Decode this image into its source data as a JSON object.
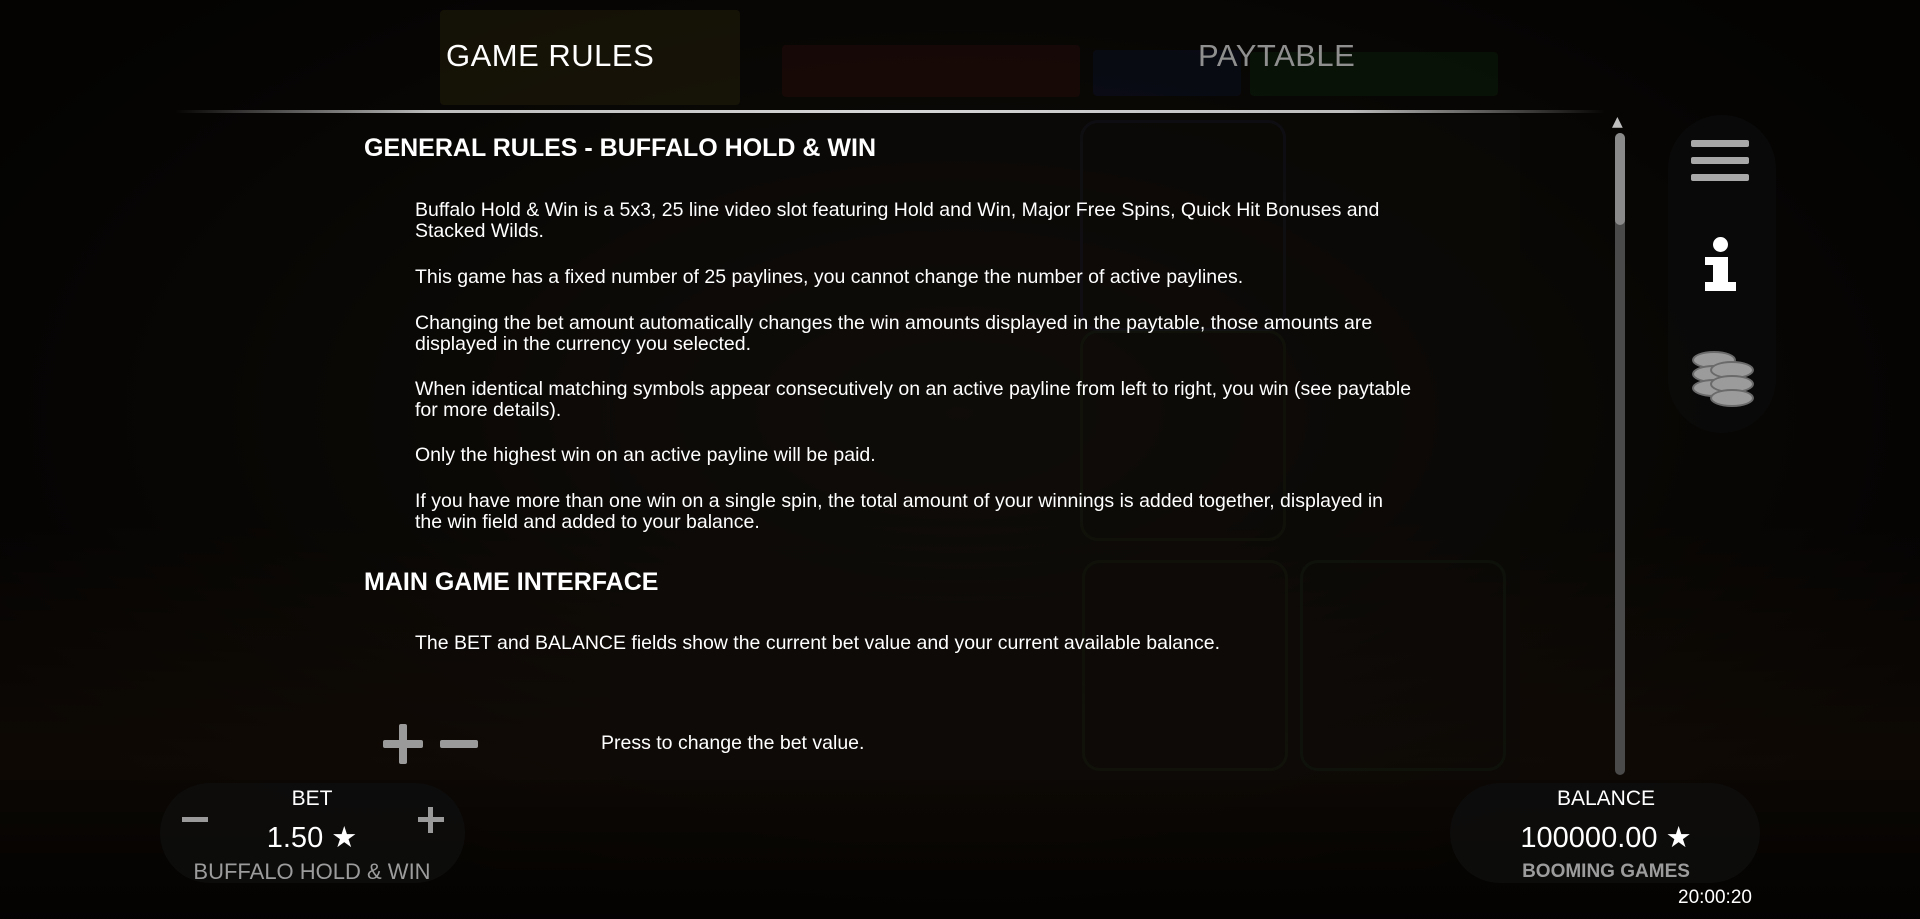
{
  "tabs": {
    "game_rules": "GAME RULES",
    "paytable": "PAYTABLE"
  },
  "sections": [
    {
      "title": "GENERAL RULES - BUFFALO HOLD & WIN",
      "paragraphs": [
        "Buffalo Hold & Win is a 5x3, 25 line video slot featuring Hold and Win, Major Free Spins, Quick Hit Bonuses and Stacked Wilds.",
        "This game has a fixed number of 25 paylines, you cannot change the number of active paylines.",
        "Changing the bet amount automatically changes the win amounts displayed in the paytable, those amounts are displayed in the currency you selected.",
        "When identical matching symbols appear consecutively on an active payline from left to right, you win (see paytable for more details).",
        "Only the highest win on an active payline will be paid.",
        "If you have more than one win on a single spin, the total amount of your winnings is added together, displayed in the win field and added to your balance."
      ]
    },
    {
      "title": "MAIN GAME INTERFACE",
      "paragraphs": [
        "The BET and BALANCE fields show the current bet value and your current available balance."
      ]
    }
  ],
  "bet_change_text": "Press to change the bet value.",
  "icons": {
    "menu": "hamburger-icon",
    "info": "info-icon",
    "coins": "coins-icon",
    "plus": "plus-icon",
    "minus": "minus-icon",
    "star": "star-icon"
  },
  "bottom": {
    "bet_label": "BET",
    "bet_value": "1.50 ★",
    "game_name": "BUFFALO HOLD & WIN",
    "balance_label": "BALANCE",
    "balance_value": "100000.00 ★",
    "provider": "BOOMING GAMES",
    "clock": "20:00:20"
  },
  "scroll_position": 0.0
}
